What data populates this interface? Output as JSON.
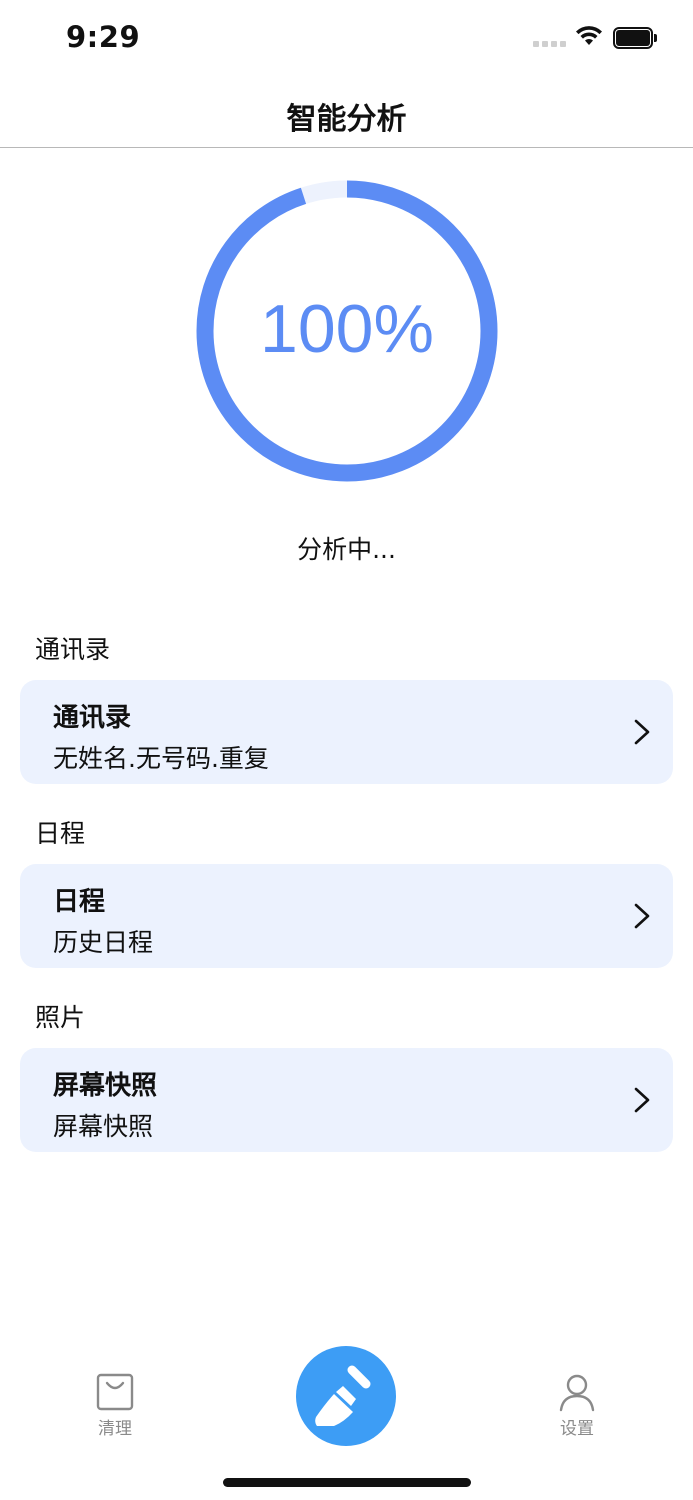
{
  "status_bar": {
    "time": "9:29"
  },
  "nav": {
    "title": "智能分析"
  },
  "progress": {
    "value_text": "100%",
    "fraction": 0.95,
    "track_color": "#edf2fd",
    "progress_color": "#5c8cf4",
    "status_text": "分析中..."
  },
  "sections": [
    {
      "header": "通讯录",
      "card": {
        "title": "通讯录",
        "subtitle": "无姓名.无号码.重复"
      }
    },
    {
      "header": "日程",
      "card": {
        "title": "日程",
        "subtitle": "历史日程"
      }
    },
    {
      "header": "照片",
      "card": {
        "title": "屏幕快照",
        "subtitle": "屏幕快照"
      }
    }
  ],
  "tab_bar": {
    "left": {
      "label": "清理",
      "icon": "bag-icon"
    },
    "center": {
      "icon": "broom-icon",
      "color": "#3d9df5"
    },
    "right": {
      "label": "设置",
      "icon": "person-icon"
    }
  }
}
